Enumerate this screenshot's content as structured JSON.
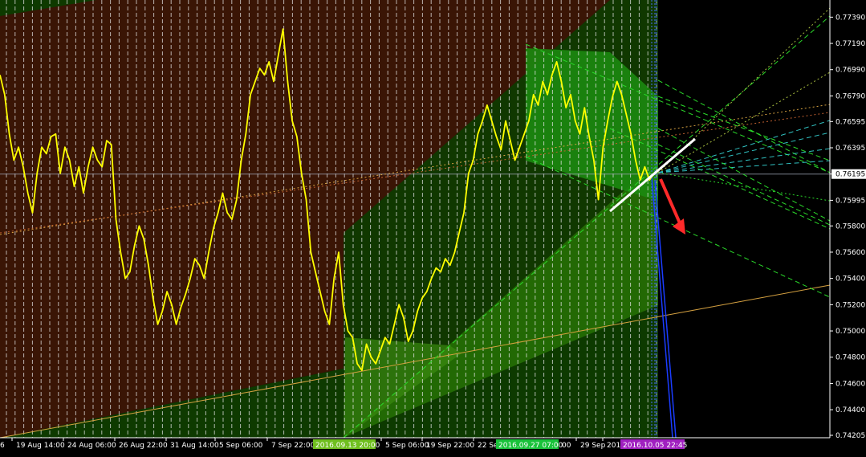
{
  "chart_data": {
    "type": "line",
    "title": "",
    "xlabel": "",
    "ylabel": "",
    "ylim": [
      0.74205,
      0.7749
    ],
    "grid": true,
    "y_ticks": [
      "0.77390",
      "0.77190",
      "0.76990",
      "0.76790",
      "0.76595",
      "0.76395",
      "0.76195",
      "0.75995",
      "0.75800",
      "0.75600",
      "0.75400",
      "0.75200",
      "0.75000",
      "0.74800",
      "0.74600",
      "0.74400",
      "0.74205"
    ],
    "current_price": "0.76195",
    "x_ticks": [
      "19 Aug 14:00",
      "24 Aug 06:00",
      "26 Aug 22:00",
      "31 Aug 14:00",
      "5 Sep 06:00",
      "7 Sep 22:00",
      "5 Sep 06:00",
      "19 Sep 22:00",
      "22 Sep",
      "29 Sep",
      "2016"
    ],
    "x_tick_partial": [
      "6",
      "00"
    ],
    "time_markers": [
      {
        "label": "2016.09.13 20:00",
        "color": "#6fbf1e"
      },
      {
        "label": "2016.09.27 07:00",
        "color": "#19c23a"
      },
      {
        "label": "2016.10.05 22:45",
        "color": "#a020c0"
      }
    ],
    "series": [
      {
        "color": "#ffff00",
        "values": [
          0.7695,
          0.768,
          0.765,
          0.763,
          0.764,
          0.7625,
          0.7605,
          0.759,
          0.762,
          0.764,
          0.7635,
          0.7648,
          0.765,
          0.762,
          0.764,
          0.763,
          0.761,
          0.7625,
          0.7605,
          0.7625,
          0.764,
          0.763,
          0.7625,
          0.7645,
          0.7642,
          0.7585,
          0.756,
          0.754,
          0.7545,
          0.7565,
          0.758,
          0.757,
          0.755,
          0.7525,
          0.7505,
          0.7515,
          0.753,
          0.752,
          0.7505,
          0.7518,
          0.7528,
          0.754,
          0.7555,
          0.755,
          0.754,
          0.756,
          0.7578,
          0.759,
          0.7605,
          0.759,
          0.7585,
          0.76,
          0.763,
          0.765,
          0.768,
          0.769,
          0.77,
          0.7695,
          0.7705,
          0.769,
          0.771,
          0.773,
          0.769,
          0.766,
          0.7648,
          0.762,
          0.76,
          0.756,
          0.7545,
          0.753,
          0.7515,
          0.7505,
          0.754,
          0.756,
          0.752,
          0.75,
          0.7495,
          0.7475,
          0.747,
          0.749,
          0.748,
          0.7475,
          0.7485,
          0.7495,
          0.749,
          0.7505,
          0.752,
          0.751,
          0.7492,
          0.75,
          0.7515,
          0.7525,
          0.753,
          0.754,
          0.7548,
          0.7545,
          0.7555,
          0.755,
          0.756,
          0.7575,
          0.759,
          0.762,
          0.763,
          0.765,
          0.766,
          0.7672,
          0.766,
          0.7648,
          0.7638,
          0.766,
          0.7645,
          0.763,
          0.764,
          0.765,
          0.766,
          0.768,
          0.7672,
          0.769,
          0.768,
          0.7695,
          0.7705,
          0.769,
          0.767,
          0.768,
          0.766,
          0.765,
          0.767,
          0.7648,
          0.763,
          0.76,
          0.764,
          0.766,
          0.7678,
          0.769,
          0.768,
          0.7665,
          0.765,
          0.763,
          0.7615,
          0.7625,
          0.7615,
          0.762
        ]
      }
    ],
    "channels": [
      {
        "name": "",
        "color": "#3a1505"
      },
      {
        "name": "",
        "color": "#0e3a00"
      },
      {
        "name": "",
        "color": "#2a7a05"
      },
      {
        "name": "",
        "color": "#1c8a10"
      }
    ]
  },
  "colors": {
    "background": "#000000",
    "price_line": "#ffff00",
    "forecast_arrow": "#ff2a2a",
    "trend_line": "#ffffff",
    "projection": "#1a3cff"
  }
}
